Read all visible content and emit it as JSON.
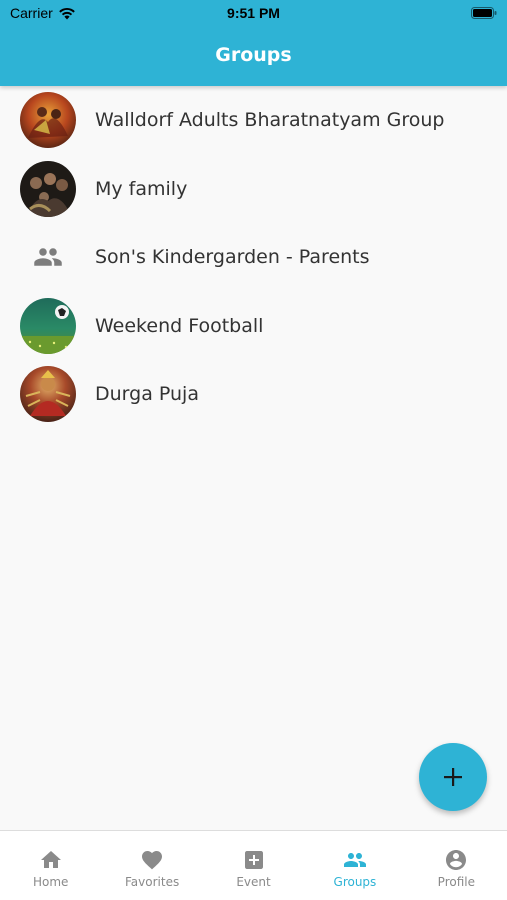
{
  "status_bar": {
    "carrier": "Carrier",
    "time": "9:51 PM"
  },
  "header": {
    "title": "Groups"
  },
  "groups": [
    {
      "name": "Walldorf Adults Bharatnatyam Group",
      "avatar": "photo"
    },
    {
      "name": "My family",
      "avatar": "photo"
    },
    {
      "name": "Son's Kindergarden - Parents",
      "avatar": "group-icon"
    },
    {
      "name": "Weekend Football",
      "avatar": "photo"
    },
    {
      "name": "Durga Puja",
      "avatar": "photo"
    }
  ],
  "fab": {
    "icon": "plus-icon"
  },
  "bottom_nav": {
    "active": "Groups",
    "items": [
      {
        "label": "Home",
        "icon": "home-icon"
      },
      {
        "label": "Favorites",
        "icon": "heart-icon"
      },
      {
        "label": "Event",
        "icon": "add-box-icon"
      },
      {
        "label": "Groups",
        "icon": "people-icon"
      },
      {
        "label": "Profile",
        "icon": "account-icon"
      }
    ]
  },
  "colors": {
    "accent": "#2eb3d5",
    "inactive": "#8a8a8a",
    "background": "#f9f9f9"
  }
}
